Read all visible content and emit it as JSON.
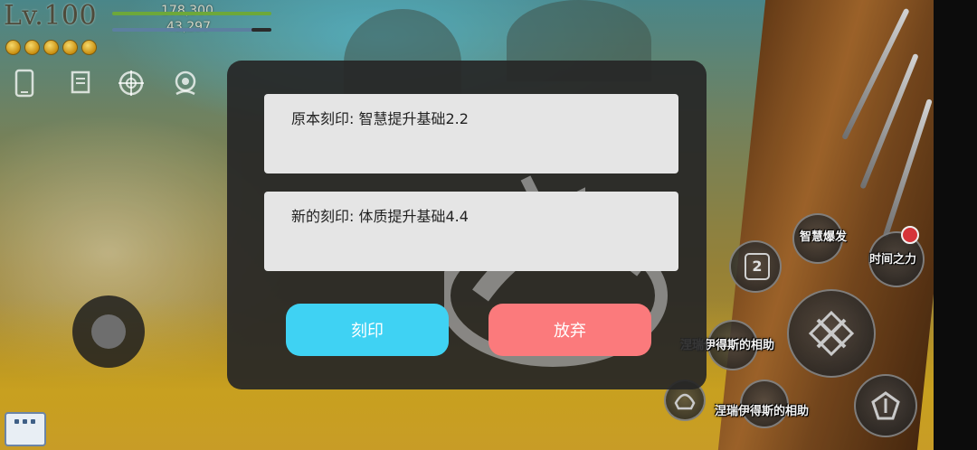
{
  "hud": {
    "level_text": "Lv.100",
    "hp_value": "178,300",
    "mp_value": "43,297",
    "coin_count": 5,
    "icons": [
      "phone-icon",
      "scroll-icon",
      "crosshair-icon",
      "support-icon"
    ]
  },
  "dialog": {
    "original_inscription": "原本刻印: 智慧提升基础2.2",
    "new_inscription": "新的刻印: 体质提升基础4.4",
    "confirm_label": "刻印",
    "cancel_label": "放弃",
    "colors": {
      "confirm": "#3fd2f3",
      "cancel": "#fb7a7c"
    }
  },
  "skills": {
    "wisdom_burst": "智慧爆发",
    "time_power": "时间之力",
    "slot_number": "2",
    "summon_help_1": "涅瑞伊得斯的相助",
    "summon_help_2": "涅瑞伊得斯的相助"
  },
  "controls": {
    "joystick": "virtual-joystick",
    "chat": "chat-icon"
  }
}
